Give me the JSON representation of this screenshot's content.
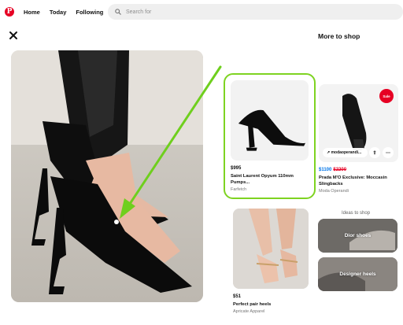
{
  "header": {
    "logo_glyph": "P",
    "nav": [
      "Home",
      "Today",
      "Following"
    ],
    "search_placeholder": "Search for"
  },
  "shop": {
    "title": "More to shop",
    "products": [
      {
        "price": "$995",
        "title_line1": "Saint Laurent Opyum 110mm",
        "title_line2": "Pumps...",
        "merchant": "Farfetch"
      },
      {
        "badge": "Sale",
        "domain": "modaoperandi...",
        "price": "$1100",
        "old_price": "$2200",
        "title_line1": "Prada M'O Exclusive: Moccasin",
        "title_line2": "Slingbacks",
        "merchant": "Moda Operandi"
      },
      {
        "price": "$51",
        "title": "Perfect pair heels",
        "merchant": "Apricate Apparel"
      }
    ],
    "ideas_title": "Ideas to shop",
    "ideas": [
      "Dior shoes",
      "Designer heels"
    ]
  },
  "colors": {
    "brand": "#e60023",
    "highlight": "#7ed321",
    "sale_price": "#0074e8"
  }
}
